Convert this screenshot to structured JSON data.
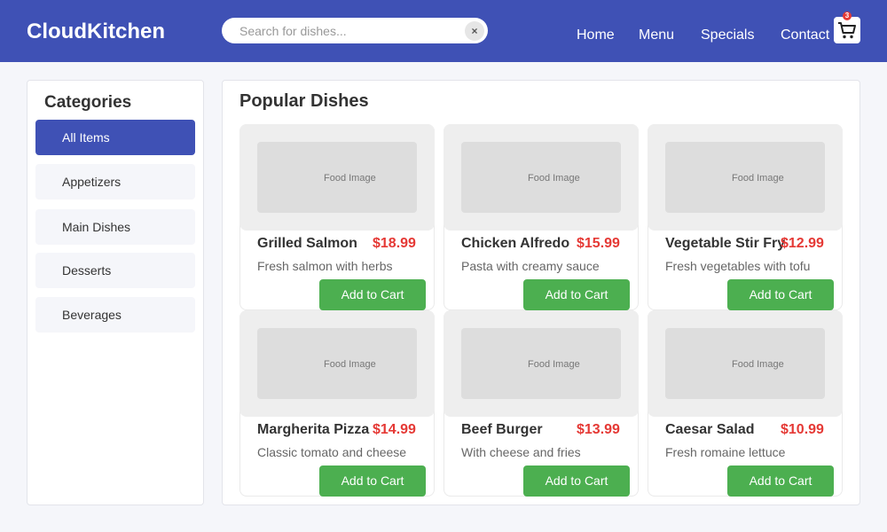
{
  "header": {
    "logo": "CloudKitchen",
    "search_placeholder": "Search for dishes...",
    "search_clear": "×",
    "nav": [
      "Home",
      "Menu",
      "Specials",
      "Contact"
    ],
    "cart_count": "3",
    "bg_color": "#3f51b5"
  },
  "sidebar": {
    "title": "Categories",
    "items": [
      {
        "label": "All Items",
        "active": true
      },
      {
        "label": "Appetizers",
        "active": false
      },
      {
        "label": "Main Dishes",
        "active": false
      },
      {
        "label": "Desserts",
        "active": false
      },
      {
        "label": "Beverages",
        "active": false
      }
    ]
  },
  "main": {
    "title": "Popular Dishes",
    "image_placeholder": "Food Image",
    "button_label": "Add to Cart",
    "dishes": [
      {
        "name": "Grilled Salmon",
        "price": "$18.99",
        "desc": "Fresh salmon with herbs"
      },
      {
        "name": "Chicken Alfredo",
        "price": "$15.99",
        "desc": "Pasta with creamy sauce"
      },
      {
        "name": "Vegetable Stir Fry",
        "price": "$12.99",
        "desc": "Fresh vegetables with tofu"
      },
      {
        "name": "Margherita Pizza",
        "price": "$14.99",
        "desc": "Classic tomato and cheese"
      },
      {
        "name": "Beef Burger",
        "price": "$13.99",
        "desc": "With cheese and fries"
      },
      {
        "name": "Caesar Salad",
        "price": "$10.99",
        "desc": "Fresh romaine lettuce"
      }
    ]
  },
  "colors": {
    "accent": "#3f51b5",
    "price": "#e53935",
    "button": "#4caf50"
  },
  "icons": {
    "cart": "shopping-cart-icon",
    "clear": "close-icon"
  }
}
